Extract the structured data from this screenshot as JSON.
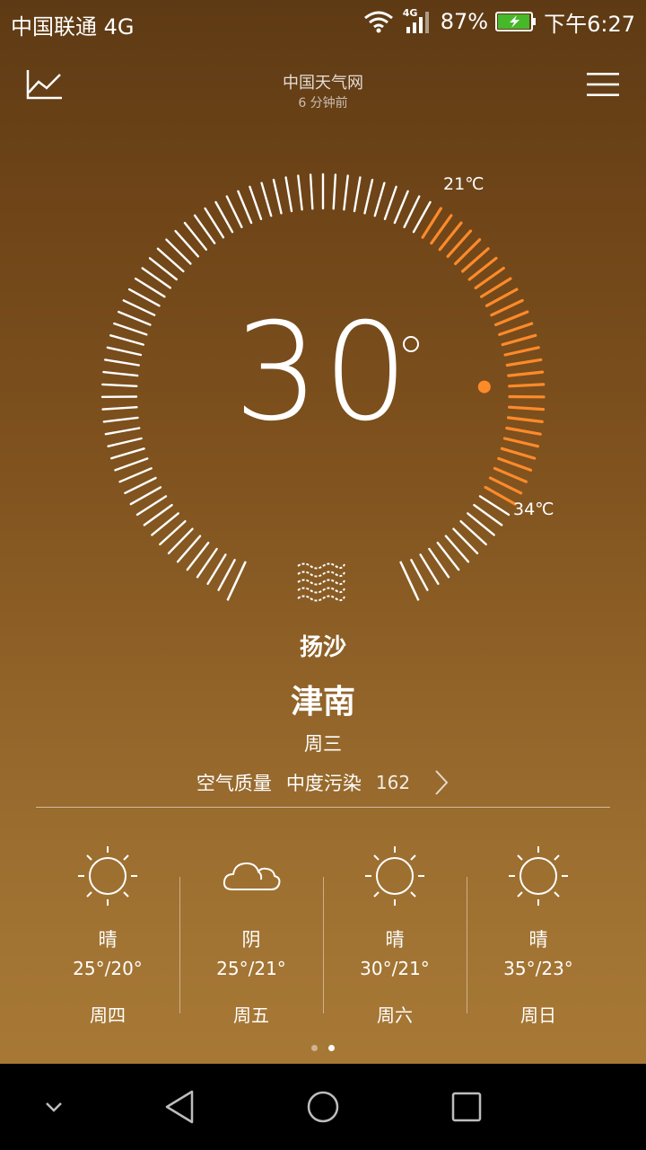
{
  "status_bar": {
    "carrier": "中国联通 4G",
    "network_badge": "4G",
    "battery_percent": "87%",
    "time": "下午6:27"
  },
  "header": {
    "source": "中国天气网",
    "updated": "6 分钟前",
    "left_icon": "trend-chart-icon",
    "right_icon": "menu-icon"
  },
  "current": {
    "temperature": "30",
    "high_label": "21℃",
    "low_label": "34℃",
    "condition": "扬沙",
    "city": "津南",
    "weekday": "周三",
    "icon": "sandstorm-icon"
  },
  "air_quality": {
    "label": "空气质量",
    "level": "中度污染",
    "value": "162"
  },
  "forecast": [
    {
      "day": "周四",
      "condition": "晴",
      "range": "25°/20°",
      "icon": "sun-icon"
    },
    {
      "day": "周五",
      "condition": "阴",
      "range": "25°/21°",
      "icon": "cloud-icon"
    },
    {
      "day": "周六",
      "condition": "晴",
      "range": "30°/21°",
      "icon": "sun-icon"
    },
    {
      "day": "周日",
      "condition": "晴",
      "range": "35°/23°",
      "icon": "sun-icon"
    }
  ],
  "pager": {
    "count": 2,
    "active": 2
  },
  "colors": {
    "accent": "#ff8a2a",
    "tick": "#ffffff",
    "navbar": "#000000"
  }
}
